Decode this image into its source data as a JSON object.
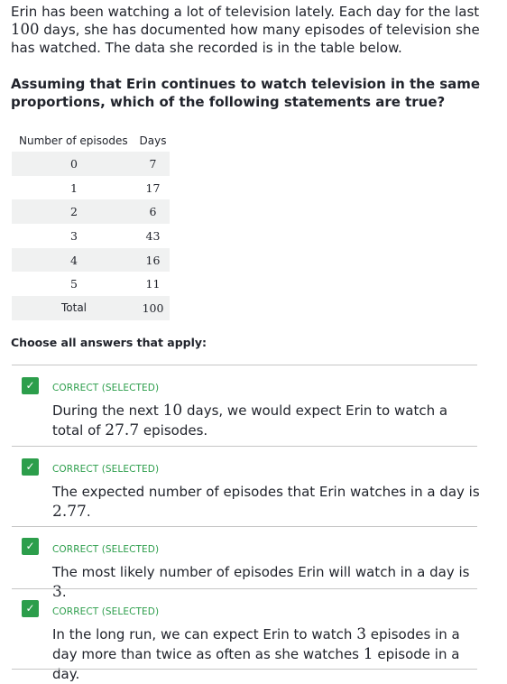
{
  "intro": {
    "p1": "Erin has been watching a lot of television lately. Each day for the last ",
    "n_days": "100",
    "p2": " days, she has documented how many episodes of television she has watched. The data she recorded is in the table below."
  },
  "question": "Assuming that Erin continues to watch television in the same proportions, which of the following statements are true?",
  "table": {
    "headers": [
      "Number of episodes",
      "Days"
    ],
    "rows": [
      [
        "0",
        "7"
      ],
      [
        "1",
        "17"
      ],
      [
        "2",
        "6"
      ],
      [
        "3",
        "43"
      ],
      [
        "4",
        "16"
      ],
      [
        "5",
        "11"
      ],
      [
        "Total",
        "100"
      ]
    ]
  },
  "choose_label": "Choose all answers that apply:",
  "choices": [
    {
      "status": "CORRECT (SELECTED)",
      "check": "✓",
      "t1": "During the next ",
      "m1": "10",
      "t2": " days, we would expect Erin to watch a total of ",
      "m2": "27.7",
      "t3": " episodes."
    },
    {
      "status": "CORRECT (SELECTED)",
      "check": "✓",
      "t1": "The expected number of episodes that Erin watches in a day is ",
      "m1": "2.77",
      "t2": "."
    },
    {
      "status": "CORRECT (SELECTED)",
      "check": "✓",
      "t1": "The most likely number of episodes Erin will watch in a day is ",
      "m1": "3",
      "t2": "."
    },
    {
      "status": "CORRECT (SELECTED)",
      "check": "✓",
      "t1": "In the long run, we can expect Erin to watch ",
      "m1": "3",
      "t2": " episodes in a day more than twice as often as she watches ",
      "m2": "1",
      "t3": " episode in a day."
    }
  ],
  "colors": {
    "correct_green": "#2c9e4b",
    "table_shade": "#f0f1f1",
    "text": "#21242c"
  }
}
